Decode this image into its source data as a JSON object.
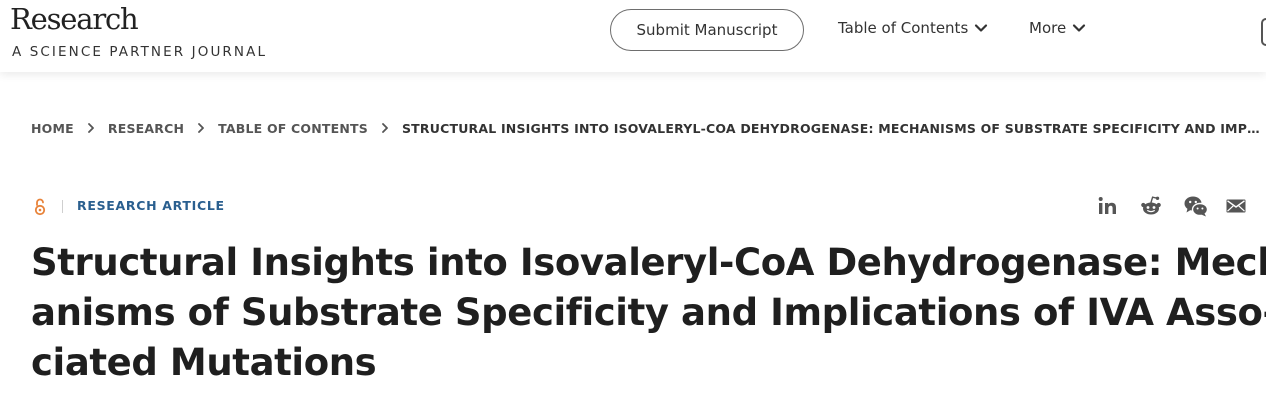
{
  "header": {
    "logo_word": "Research",
    "logo_tagline": "A SCIENCE PARTNER JOURNAL",
    "submit_label": "Submit Manuscript",
    "nav": {
      "toc_label": "Table of Contents",
      "more_label": "More"
    }
  },
  "breadcrumb": {
    "items": [
      "HOME",
      "RESEARCH",
      "TABLE OF CONTENTS"
    ],
    "current": "STRUCTURAL INSIGHTS INTO ISOVALERYL-COA DEHYDROGENASE: MECHANISMS OF SUBSTRATE SPECIFICITY AND IMPLICATIONS..."
  },
  "article": {
    "type_label": "RESEARCH ARTICLE",
    "title_lines": [
      "Structural Insights into Isovaleryl-CoA Dehydrogenase: Mech-",
      "anisms of Substrate Specificity and Implications of IVA Asso-",
      "ciated Mutations"
    ]
  },
  "share": {
    "icons": [
      "linkedin-icon",
      "reddit-icon",
      "wechat-icon",
      "email-icon"
    ]
  },
  "colors": {
    "accent_blue": "#2a5f8f",
    "open_access_orange": "#e8833a",
    "text_dark": "#1f1f1f",
    "icon_gray": "#555555"
  }
}
